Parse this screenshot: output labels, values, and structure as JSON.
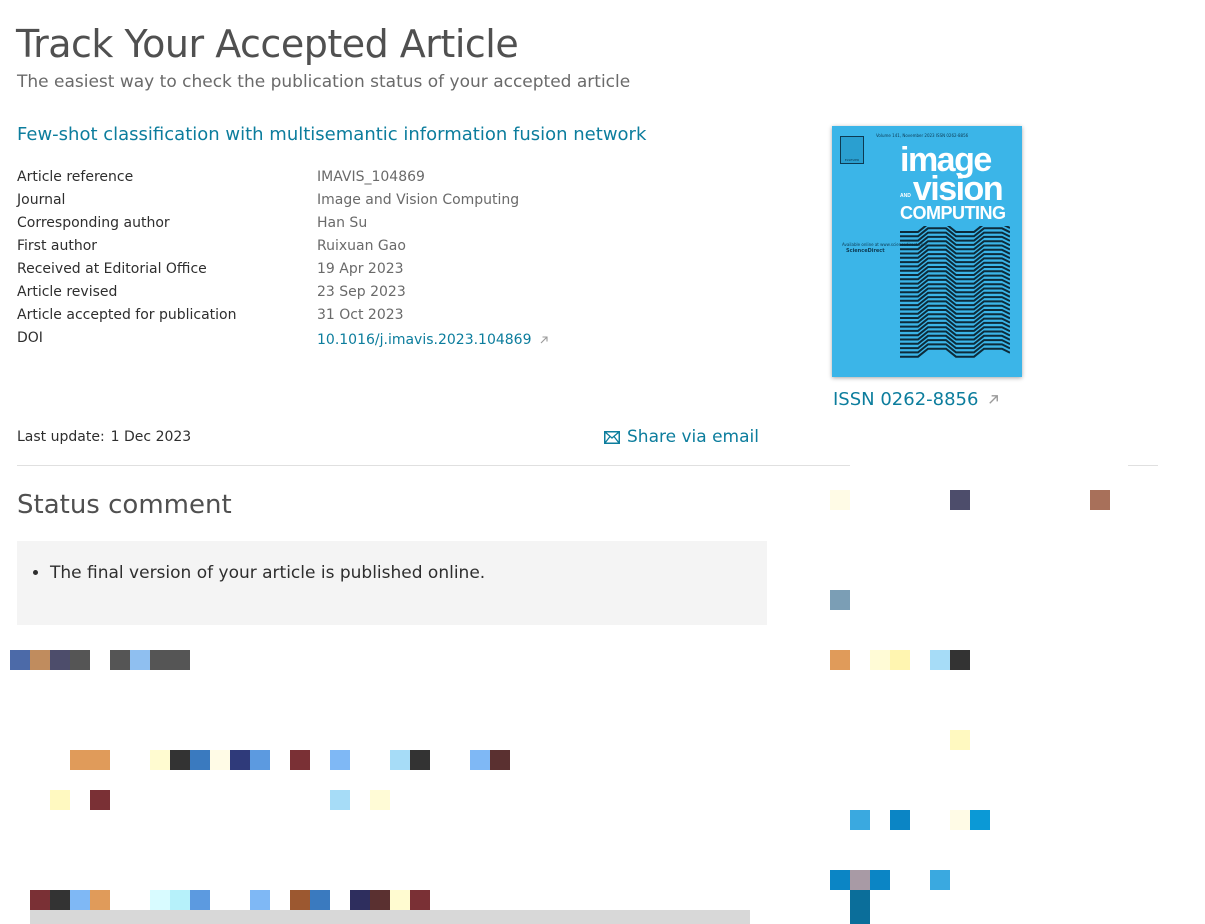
{
  "header": {
    "title": "Track Your Accepted Article",
    "subtitle": "The easiest way to check the publication status of your accepted article"
  },
  "article": {
    "title": "Few-shot classification with multisemantic information fusion network",
    "details": [
      {
        "label": "Article reference",
        "value": "IMAVIS_104869"
      },
      {
        "label": "Journal",
        "value": "Image and Vision Computing"
      },
      {
        "label": "Corresponding author",
        "value": "Han Su"
      },
      {
        "label": "First author",
        "value": "Ruixuan Gao"
      },
      {
        "label": "Received at Editorial Office",
        "value": "19 Apr 2023"
      },
      {
        "label": "Article revised",
        "value": "23 Sep 2023"
      },
      {
        "label": "Article accepted for publication",
        "value": "31 Oct 2023"
      },
      {
        "label": "DOI",
        "value": "10.1016/j.imavis.2023.104869"
      }
    ]
  },
  "journal_cover": {
    "topline": "Volume 141, November 2023        ISSN 0262-8856",
    "publisher_logo": "ELSEVIER",
    "word1": "image",
    "word_and": "AND",
    "word2": "vision",
    "word3": "COMPUTING",
    "availability": "Available online at www.sciencedirect.com",
    "sciencedirect": "ScienceDirect",
    "issn_link": "ISSN 0262-8856"
  },
  "meta": {
    "last_update_label": "Last update:",
    "last_update_value": "1 Dec 2023",
    "share_label": "Share via email"
  },
  "status": {
    "heading": "Status comment",
    "comments": [
      "The final version of your article is published online."
    ]
  },
  "colors": {
    "link": "#0c7d9d",
    "cover_bg": "#3bb5e8",
    "status_bg": "#f4f4f4"
  },
  "icons": {
    "external": "external-link-icon",
    "mail": "mail-icon"
  }
}
